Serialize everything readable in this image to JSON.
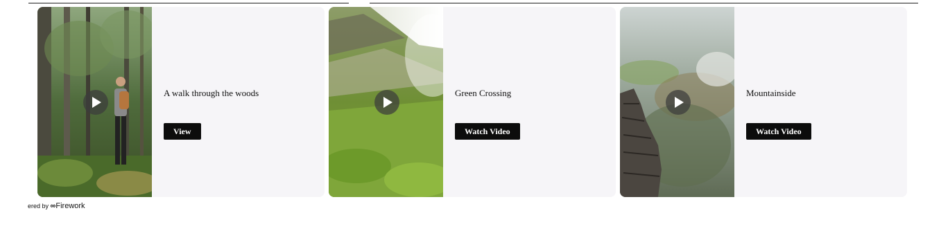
{
  "cards": [
    {
      "title": "A walk through the woods",
      "button_label": "View",
      "thumb_icon": "forest-hiker-thumbnail",
      "play_icon": "play-icon"
    },
    {
      "title": "Green Crossing",
      "button_label": "Watch Video",
      "thumb_icon": "green-hillside-thumbnail",
      "play_icon": "play-icon"
    },
    {
      "title": "Mountainside",
      "button_label": "Watch Video",
      "thumb_icon": "misty-cliffs-thumbnail",
      "play_icon": "play-icon"
    }
  ],
  "footer": {
    "prefix": "ered by",
    "logo": "∞",
    "brand": "Firework"
  }
}
